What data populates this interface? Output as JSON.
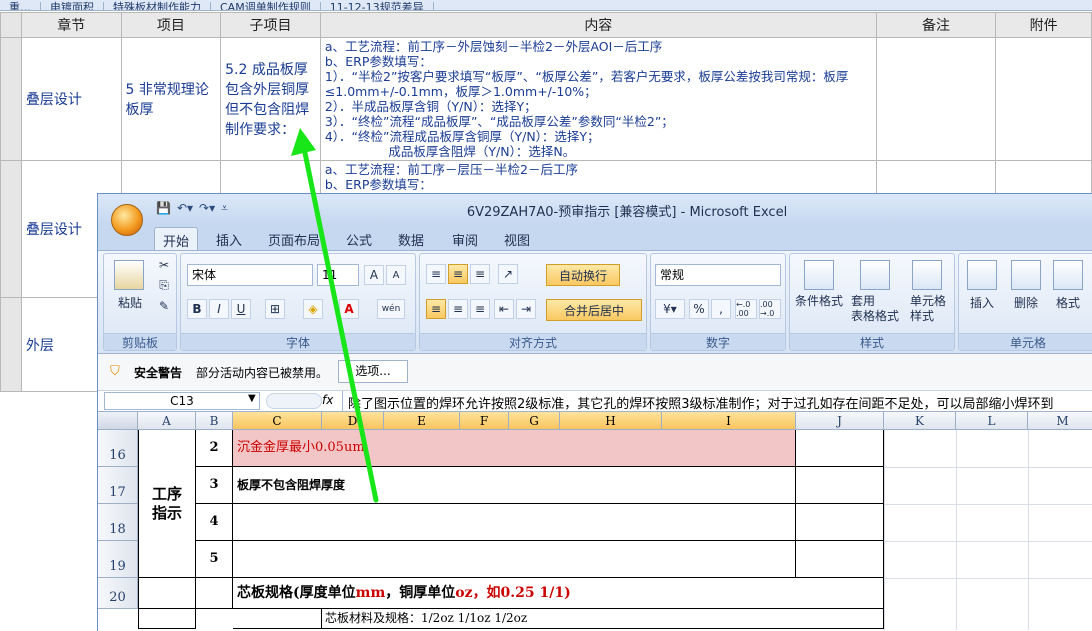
{
  "top_tabs": [
    "重…",
    "电镀面积",
    "特殊板材制作能力",
    "CAM调单制作规则",
    "11-12-13规范差异"
  ],
  "bg_table": {
    "headers": [
      "章节",
      "项目",
      "子项目",
      "内容",
      "备注",
      "附件"
    ],
    "rows": [
      {
        "chapter": "叠层设计",
        "item": "5 非常规理论板厚",
        "sub": "5.2 成品板厚包含外层铜厚但不包含阻焊制作要求：",
        "content": "a、工艺流程：前工序－外层蚀刻－半检2－外层AOI－后工序\nb、ERP参数填写：\n1）．“半检2”按客户要求填写“板厚”、“板厚公差”，若客户无要求，板厚公差按我司常规：板厚≤1.0mm+/-0.1mm，板厚＞1.0mm+/-10%；\n2）．半成品板厚含铜（Y/N）：选择Y；\n3）．“终检”流程“成品板厚”、“成品板厚公差”参数同“半检2”；\n4）．“终检”流程成品板厚含铜厚（Y/N）：选择Y；\n                成品板厚含阻焊（Y/N）：选择N。"
      },
      {
        "chapter": "叠层设计",
        "item": "",
        "sub": "",
        "content": "a、工艺流程：前工序－层压－半检2－后工序\nb、ERP参数填写："
      },
      {
        "chapter": "外层",
        "item": "",
        "sub": "",
        "content": ""
      }
    ]
  },
  "excel": {
    "title": "6V29ZAH7A0-预审指示  [兼容模式] - Microsoft Excel",
    "ribbon_tabs": [
      "开始",
      "插入",
      "页面布局",
      "公式",
      "数据",
      "审阅",
      "视图"
    ],
    "clipboard": {
      "paste": "粘贴",
      "label": "剪贴板"
    },
    "font": {
      "name": "宋体",
      "size": "11",
      "bold": "B",
      "italic": "I",
      "underline": "U",
      "label": "字体",
      "grow": "A",
      "shrink": "A",
      "wen": "wén",
      "a_color": "A"
    },
    "align": {
      "wrap": "自动换行",
      "merge": "合并后居中",
      "label": "对齐方式"
    },
    "number": {
      "format": "常规",
      "percent": "%",
      "comma": ",",
      "label": "数字",
      "inc": "←.0 .00",
      "dec": ".00 →.0"
    },
    "styles": {
      "cond": "条件格式",
      "table": "套用\n表格格式",
      "cell": "单元格\n样式",
      "label": "样式"
    },
    "cells": {
      "insert": "插入",
      "delete": "删除",
      "format": "格式",
      "label": "单元格"
    },
    "warning": {
      "title": "安全警告",
      "text": "部分活动内容已被禁用。",
      "options": "选项..."
    },
    "namebox": "C13",
    "fx": "fx",
    "formula": "除了图示位置的焊环允许按照2级标准，其它孔的焊环按照3级标准制作；对于过孔如存在间距不足处，可以局部缩小焊环到",
    "columns": [
      "A",
      "B",
      "C",
      "D",
      "E",
      "F",
      "G",
      "H",
      "I",
      "J",
      "K",
      "L",
      "M"
    ],
    "rows": [
      "16",
      "17",
      "18",
      "19",
      "20"
    ],
    "cell_section": "工序\n指示",
    "b_values": [
      "2",
      "3",
      "4",
      "5"
    ],
    "c16": "沉金金厚最小0.05um",
    "c17": "板厚不包含阻焊厚度",
    "c20_parts": [
      "芯板规格(厚度单位",
      "mm",
      "，铜厚单位",
      "oz",
      "，如0.25 1/1)"
    ],
    "c21": "芯板材料及规格：1/2oz 1/1oz 1/2oz"
  },
  "colors": {
    "arrow": "#19e619",
    "pink": "#f2c6c6",
    "red": "#cc0000",
    "blue_text": "#1a3c94"
  }
}
